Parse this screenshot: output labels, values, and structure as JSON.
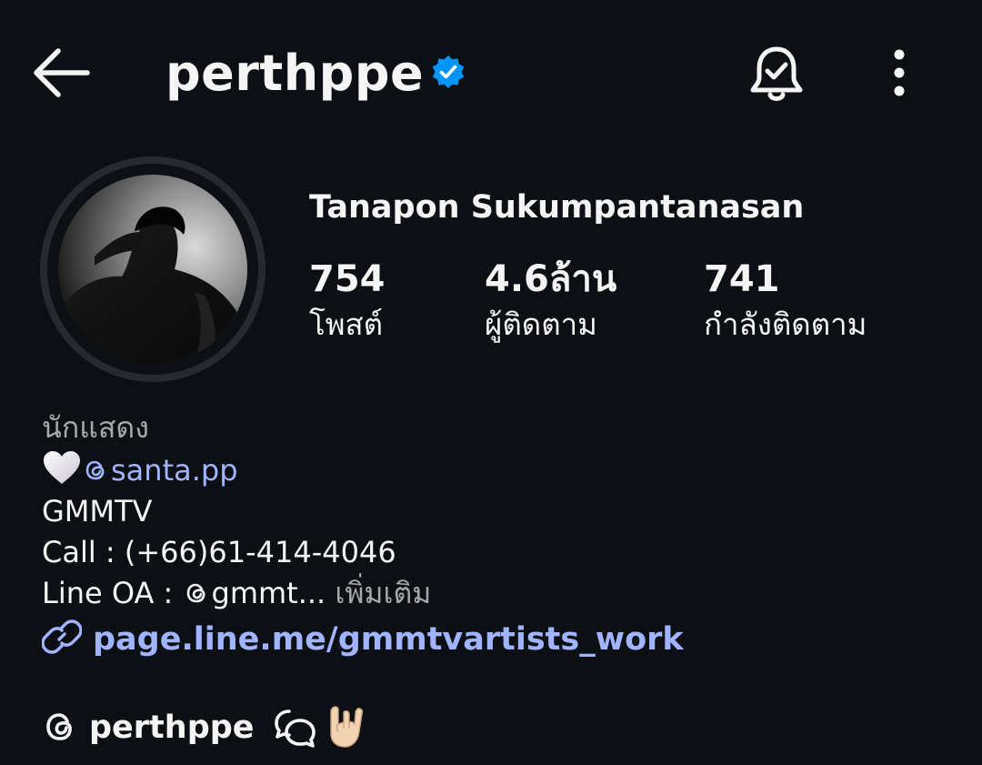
{
  "header": {
    "username": "perthppe",
    "verified": true,
    "icons": {
      "back": "back-arrow-icon",
      "verified": "verified-badge-icon",
      "notifications": "bell-check-icon",
      "more": "more-vertical-icon"
    }
  },
  "profile": {
    "full_name": "Tanapon Sukumpantanasan",
    "stats": [
      {
        "value": "754",
        "label": "โพสต์"
      },
      {
        "value": "4.6ล้าน",
        "label": "ผู้ติดตาม"
      },
      {
        "value": "741",
        "label": "กำลังติดตาม"
      }
    ],
    "category": "นักแสดง",
    "bio": {
      "mention": "santa.pp",
      "line2": "GMMTV",
      "line3": "Call : (+66)61-414-4046",
      "line4_prefix": "Line OA : ",
      "line4_truncated": "gmmt...",
      "more_label": "เพิ่มเติม"
    },
    "link": "page.line.me/gmmtvartists_work",
    "threads_username": "perthppe"
  },
  "colors": {
    "background": "#0c1014",
    "text": "#f5f5f5",
    "secondary_text": "#a8a8a8",
    "link": "#a0b4ff",
    "verified_blue": "#0095f6",
    "avatar_ring": "#262a2f"
  }
}
